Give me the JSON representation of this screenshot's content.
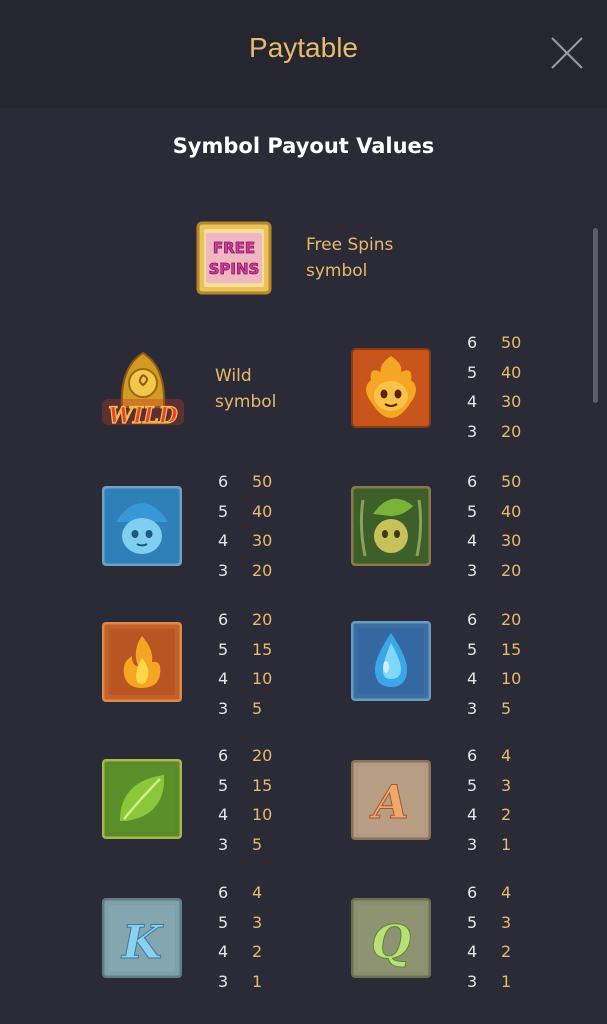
{
  "header": {
    "title": "Paytable"
  },
  "section_title": "Symbol Payout Values",
  "free_spins": {
    "logo": "FREE SPINS",
    "description_line1": "Free Spins",
    "description_line2": "symbol"
  },
  "wild": {
    "logo": "WILD",
    "description_line1": "Wild",
    "description_line2": "symbol"
  },
  "symbols": {
    "fire_spirit": {
      "name": "fire-spirit",
      "payouts": [
        {
          "count": "6",
          "value": "50"
        },
        {
          "count": "5",
          "value": "40"
        },
        {
          "count": "4",
          "value": "30"
        },
        {
          "count": "3",
          "value": "20"
        }
      ]
    },
    "water_spirit": {
      "name": "water-spirit",
      "payouts": [
        {
          "count": "6",
          "value": "50"
        },
        {
          "count": "5",
          "value": "40"
        },
        {
          "count": "4",
          "value": "30"
        },
        {
          "count": "3",
          "value": "20"
        }
      ]
    },
    "leaf_spirit": {
      "name": "leaf-spirit",
      "payouts": [
        {
          "count": "6",
          "value": "50"
        },
        {
          "count": "5",
          "value": "40"
        },
        {
          "count": "4",
          "value": "30"
        },
        {
          "count": "3",
          "value": "20"
        }
      ]
    },
    "fire_gem": {
      "name": "fire-gem",
      "payouts": [
        {
          "count": "6",
          "value": "20"
        },
        {
          "count": "5",
          "value": "15"
        },
        {
          "count": "4",
          "value": "10"
        },
        {
          "count": "3",
          "value": "5"
        }
      ]
    },
    "water_gem": {
      "name": "water-gem",
      "payouts": [
        {
          "count": "6",
          "value": "20"
        },
        {
          "count": "5",
          "value": "15"
        },
        {
          "count": "4",
          "value": "10"
        },
        {
          "count": "3",
          "value": "5"
        }
      ]
    },
    "leaf_gem": {
      "name": "leaf-gem",
      "payouts": [
        {
          "count": "6",
          "value": "20"
        },
        {
          "count": "5",
          "value": "15"
        },
        {
          "count": "4",
          "value": "10"
        },
        {
          "count": "3",
          "value": "5"
        }
      ]
    },
    "letter_a": {
      "letter": "A",
      "payouts": [
        {
          "count": "6",
          "value": "4"
        },
        {
          "count": "5",
          "value": "3"
        },
        {
          "count": "4",
          "value": "2"
        },
        {
          "count": "3",
          "value": "1"
        }
      ]
    },
    "letter_k": {
      "letter": "K",
      "payouts": [
        {
          "count": "6",
          "value": "4"
        },
        {
          "count": "5",
          "value": "3"
        },
        {
          "count": "4",
          "value": "2"
        },
        {
          "count": "3",
          "value": "1"
        }
      ]
    },
    "letter_q": {
      "letter": "Q",
      "payouts": [
        {
          "count": "6",
          "value": "4"
        },
        {
          "count": "5",
          "value": "3"
        },
        {
          "count": "4",
          "value": "2"
        },
        {
          "count": "3",
          "value": "1"
        }
      ]
    }
  },
  "colors": {
    "background": "#2b2b37",
    "header": "#262631",
    "accent_gold": "#e8b96a",
    "count_text": "#e6e6e6",
    "title_text": "#ffffff"
  }
}
